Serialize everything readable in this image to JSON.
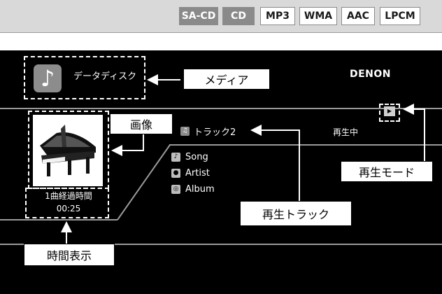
{
  "formats": [
    {
      "label": "SA-CD",
      "active": true
    },
    {
      "label": "CD",
      "active": true
    },
    {
      "label": "MP3",
      "active": false
    },
    {
      "label": "WMA",
      "active": false
    },
    {
      "label": "AAC",
      "active": false
    },
    {
      "label": "LPCM",
      "active": false
    }
  ],
  "display": {
    "media_label": "データディスク",
    "brand": "DENON",
    "track": "トラック2",
    "status": "再生中",
    "elapsed_label": "1曲経過時間",
    "elapsed_time": "00:25",
    "song": "Song",
    "artist": "Artist",
    "album": "Album"
  },
  "callouts": {
    "media": "メディア",
    "image": "画像",
    "play_mode": "再生モード",
    "play_track": "再生トラック",
    "time_display": "時間表示"
  },
  "colors": {
    "screen": "#000000",
    "format_active": "#8a8a8a",
    "strip": "#d9d9d9"
  }
}
